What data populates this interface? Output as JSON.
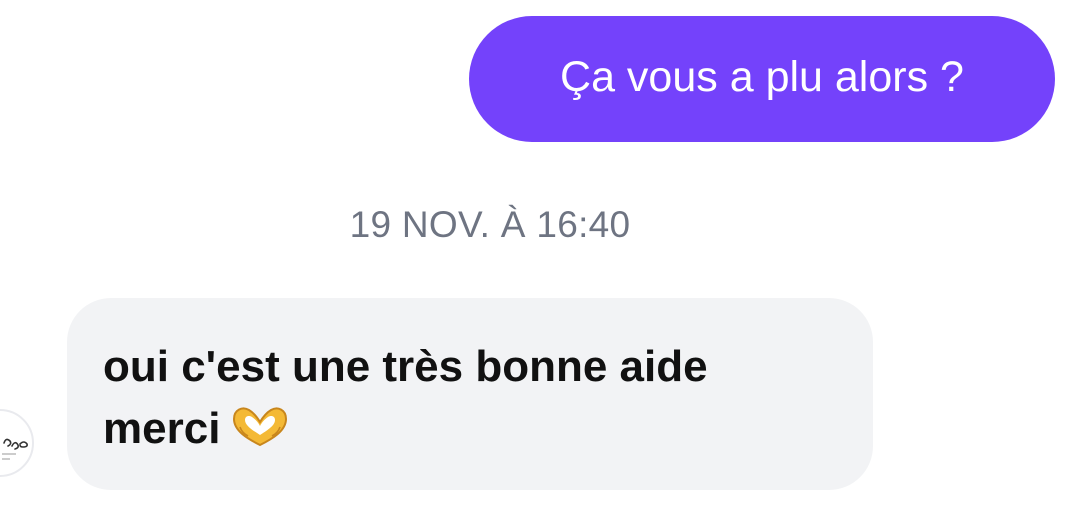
{
  "conversation": {
    "outgoing_message": "Ça vous a plu alors ?",
    "timestamp": "19 NOV. À 16:40",
    "incoming_message_line1": "oui c'est une très bonne aide",
    "incoming_message_line2": "merci",
    "incoming_emoji": "heart-hands-icon"
  },
  "colors": {
    "outgoing_bubble": "#7442fb",
    "incoming_bubble": "#f2f3f5",
    "timestamp_text": "#6e7482"
  }
}
